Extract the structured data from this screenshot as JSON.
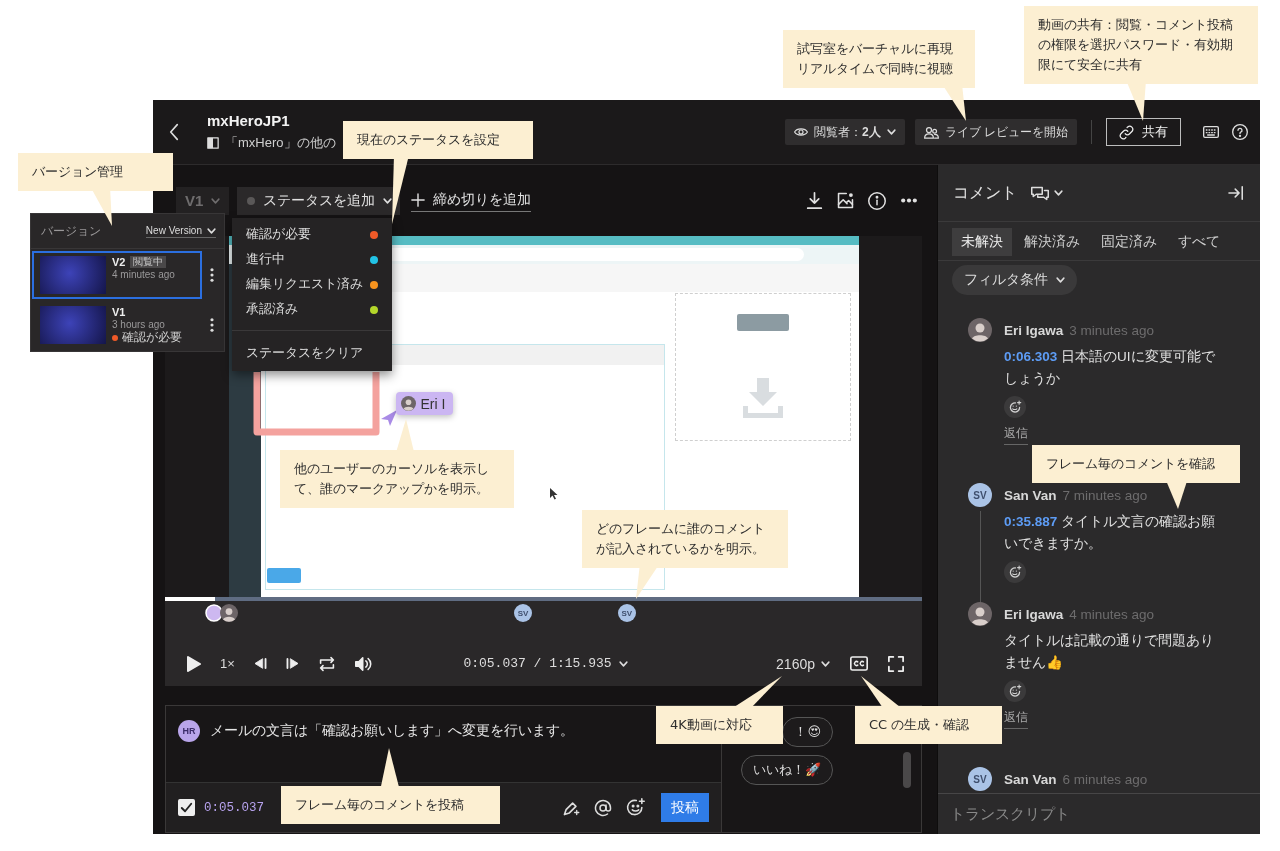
{
  "header": {
    "title": "mxHeroJP1",
    "subtitle": "「mxHero」の他の",
    "viewers": "閲覧者：**2人**",
    "live_review": "ライブ レビューを開始",
    "share": "共有"
  },
  "toolbar": {
    "version": "V1",
    "status": "ステータスを追加",
    "deadline": "締め切りを追加"
  },
  "video": {
    "cursor_label": "Eri I"
  },
  "player": {
    "progress": {
      "level": 0.066
    },
    "markers": [
      {
        "kind": "draft"
      },
      {
        "kind": "photo"
      },
      {
        "kind": "initials",
        "initials": "SV"
      },
      {
        "kind": "initials",
        "initials": "SV"
      }
    ],
    "speed": "1×",
    "time": "0:05.037 / 1:15.935",
    "quality": "2160p"
  },
  "composer": {
    "avatar": "HR",
    "text": "メールの文言は「確認お願いします」へ変更を行います。",
    "timestamp_checked": true,
    "timestamp": "0:05.037",
    "submit": "投稿",
    "reactions": [
      "！😍",
      "いいね！🚀"
    ]
  },
  "sidebar": {
    "title": "コメント",
    "tabs": [
      {
        "label": "未解決",
        "selected": true
      },
      {
        "label": "解決済み",
        "selected": false
      },
      {
        "label": "固定済み",
        "selected": false
      },
      {
        "label": "すべて",
        "selected": false
      }
    ],
    "filter": "フィルタ条件",
    "comments": [
      {
        "author": "Eri Igawa",
        "avatar": {
          "kind": "photo"
        },
        "time": "3 minutes ago",
        "timestamp": "0:06.303",
        "text": "日本語のUIに変更可能でしょうか",
        "reply_link": "返信"
      },
      {
        "author": "San Van",
        "avatar": {
          "kind": "initials",
          "initials": "SV"
        },
        "time": "7 minutes ago",
        "timestamp": "0:35.887",
        "text": "タイトル文言の確認お願いできますか。",
        "replies": [
          {
            "author": "Eri Igawa",
            "avatar": {
              "kind": "photo"
            },
            "time": "4 minutes ago",
            "text": "タイトルは記載の通りで問題ありません👍",
            "reply_link": "返信"
          }
        ]
      },
      {
        "author": "San Van",
        "avatar": {
          "kind": "initials",
          "initials": "SV"
        },
        "time": "6 minutes ago"
      }
    ],
    "footer": "トランスクリプト"
  },
  "version_panel": {
    "title": "バージョン",
    "new_version": "New Version",
    "versions": [
      {
        "name": "V2",
        "badge": "閲覧中",
        "time": "4 minutes ago",
        "selected": true
      },
      {
        "name": "V1",
        "time": "3 hours ago",
        "status": {
          "label": "確認が必要",
          "color": "#f05a28"
        },
        "selected": false
      }
    ]
  },
  "status_menu": {
    "options": [
      {
        "label": "確認が必要",
        "color": "#f05a28"
      },
      {
        "label": "進行中",
        "color": "#22c3e6"
      },
      {
        "label": "編集リクエスト済み",
        "color": "#f7931e"
      },
      {
        "label": "承認済み",
        "color": "#b4d62a"
      }
    ],
    "clear": "ステータスをクリア"
  },
  "callouts": [
    {
      "text": "試写室をバーチャルに再現リアルタイムで同時に視聴"
    },
    {
      "text": "動画の共有：閲覧・コメント投稿の権限を選択パスワード・有効期限にて安全に共有"
    },
    {
      "text": "現在のステータスを設定"
    },
    {
      "text": "バージョン管理"
    },
    {
      "text": "他のユーザーのカーソルを表示して、誰のマークアップかを明示。"
    },
    {
      "text": "フレーム毎のコメントを確認"
    },
    {
      "text": "どのフレームに誰のコメントが記入されているかを明示。"
    },
    {
      "text": "4K動画に対応"
    },
    {
      "text": "CC の生成・確認"
    },
    {
      "text": "フレーム毎のコメントを投稿"
    }
  ]
}
